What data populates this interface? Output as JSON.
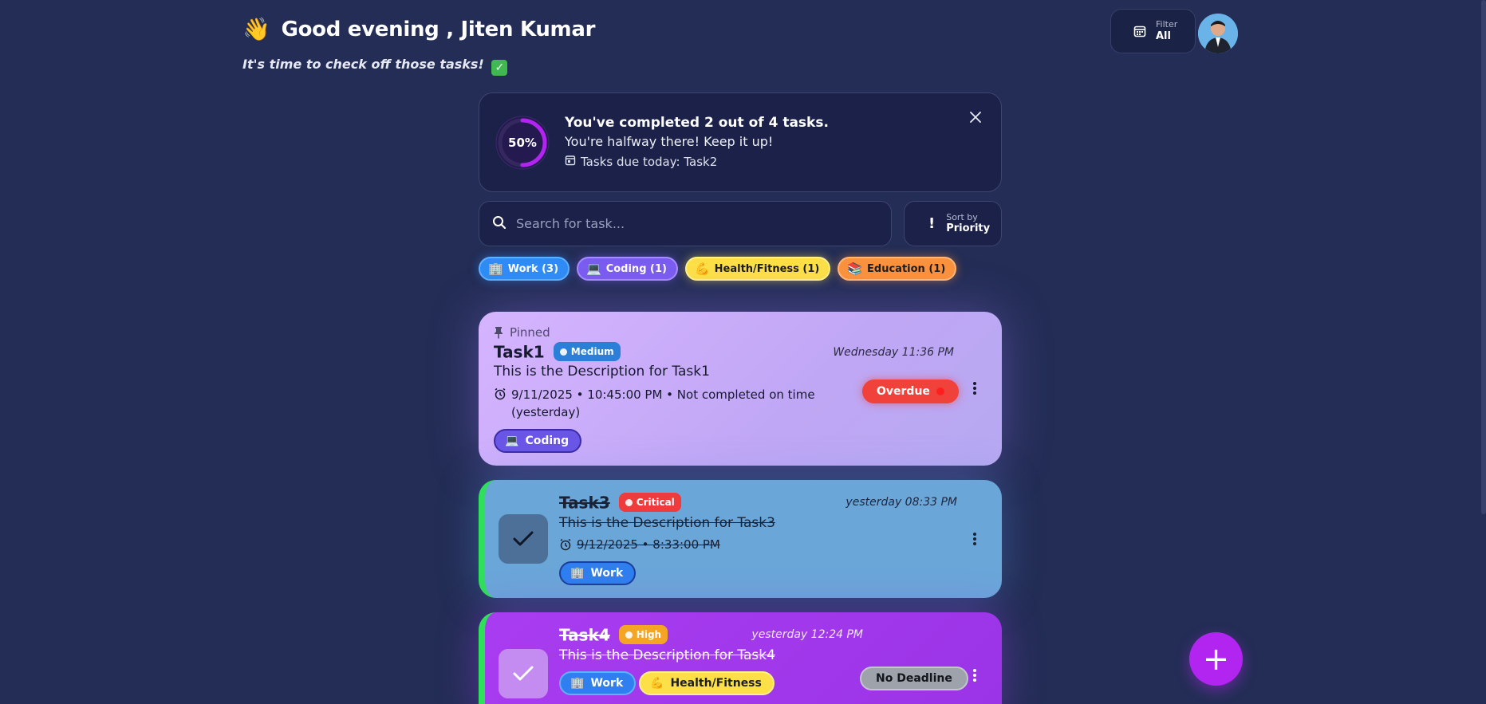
{
  "header": {
    "wave_emoji": "👋",
    "greeting": "Good evening , Jiten Kumar",
    "subtitle": "It's time to check off those tasks!",
    "subtitle_emoji": "✓"
  },
  "filter": {
    "label": "Filter",
    "value": "All"
  },
  "progress": {
    "percent_label": "50%",
    "percent": 50,
    "title": "You've completed 2 out of 4 tasks.",
    "message": "You're halfway there! Keep it up!",
    "due_today": "Tasks due today: Task2"
  },
  "search": {
    "placeholder": "Search for task..."
  },
  "sort": {
    "label": "Sort by",
    "value": "Priority"
  },
  "categories": [
    {
      "emoji": "🏢",
      "label": "Work (3)",
      "color": "#2f8cf5"
    },
    {
      "emoji": "💻",
      "label": "Coding (1)",
      "color": "#7b5cf0"
    },
    {
      "emoji": "💪",
      "label": "Health/Fitness (1)",
      "color": "#fde047"
    },
    {
      "emoji": "📚",
      "label": "Education (1)",
      "color": "#fb923c"
    }
  ],
  "tasks": [
    {
      "pinned_label": "Pinned",
      "name": "Task1",
      "priority": "Medium",
      "time": "Wednesday 11:36 PM",
      "description": "This is the Description for Task1",
      "due_line1": "9/11/2025 • 10:45:00 PM • Not completed on time",
      "due_line2": "(yesterday)",
      "tag": {
        "emoji": "💻",
        "label": "Coding"
      },
      "status": "Overdue"
    },
    {
      "name": "Task3",
      "priority": "Critical",
      "time": "yesterday 08:33 PM",
      "description": "This is the Description for Task3",
      "due": "9/12/2025 • 8:33:00 PM",
      "tag": {
        "emoji": "🏢",
        "label": "Work"
      }
    },
    {
      "name": "Task4",
      "priority": "High",
      "time": "yesterday 12:24 PM",
      "description": "This is the Description for Task4",
      "tags": [
        {
          "emoji": "🏢",
          "label": "Work"
        },
        {
          "emoji": "💪",
          "label": "Health/Fitness"
        }
      ],
      "status": "No Deadline"
    }
  ],
  "fab": {
    "label": "+"
  },
  "colors": {
    "background": "#232d55",
    "accent": "#b224f0",
    "medium": "#2b7fd9",
    "critical": "#ef3b3b",
    "high": "#f5a524",
    "overdue": "#f0413a",
    "done_border": "#2ee05a"
  }
}
